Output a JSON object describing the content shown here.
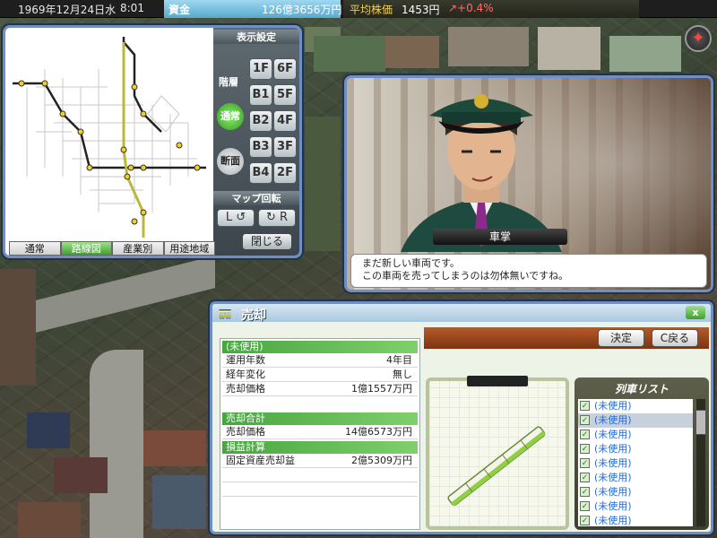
{
  "status": {
    "date": "1969年12月24日水",
    "time": "8:01",
    "funds_label": "資金",
    "funds_value": "126億3656万円",
    "stock_label": "平均株価",
    "stock_value": "1453円",
    "stock_change": "↗+0.4%"
  },
  "map_panel": {
    "display_title": "表示設定",
    "floor_label": "階層",
    "floors_left": [
      "1F",
      "B1",
      "B2",
      "B3",
      "B4"
    ],
    "floors_right": [
      "6F",
      "5F",
      "4F",
      "3F",
      "2F"
    ],
    "mode_normal": "通常",
    "mode_section": "断面",
    "rotate_title": "マップ回転",
    "rotate_left": "L",
    "rotate_right": "R",
    "tabs": [
      "通常",
      "路線図",
      "産業別",
      "用途地域"
    ],
    "active_tab": "路線図",
    "close_label": "閉じる"
  },
  "dialog": {
    "speaker": "車掌",
    "line1": "まだ新しい車両です。",
    "line2": "この車両を売ってしまうのは勿体無いですね。"
  },
  "sell_window": {
    "title": "売却",
    "close": "x",
    "confirm": "決定",
    "back": "C戻る",
    "section_unused": "(未使用)",
    "years_label": "運用年数",
    "years_value": "4年目",
    "aging_label": "経年変化",
    "aging_value": "無し",
    "price_label": "売却価格",
    "price_value": "1億1557万円",
    "total_head": "売却合計",
    "total_label": "売却価格",
    "total_value": "14億6573万円",
    "profit_head": "損益計算",
    "profit_label": "固定資産売却益",
    "profit_value": "2億5309万円",
    "list_title": "列車リスト",
    "list_items": [
      "(未使用)",
      "(未使用)",
      "(未使用)",
      "(未使用)",
      "(未使用)",
      "(未使用)",
      "(未使用)",
      "(未使用)",
      "(未使用)"
    ]
  },
  "colors": {
    "accent_green": "#3ea030",
    "frame_blue": "#6f8fc4",
    "funds_bg": "#58a9cf"
  }
}
